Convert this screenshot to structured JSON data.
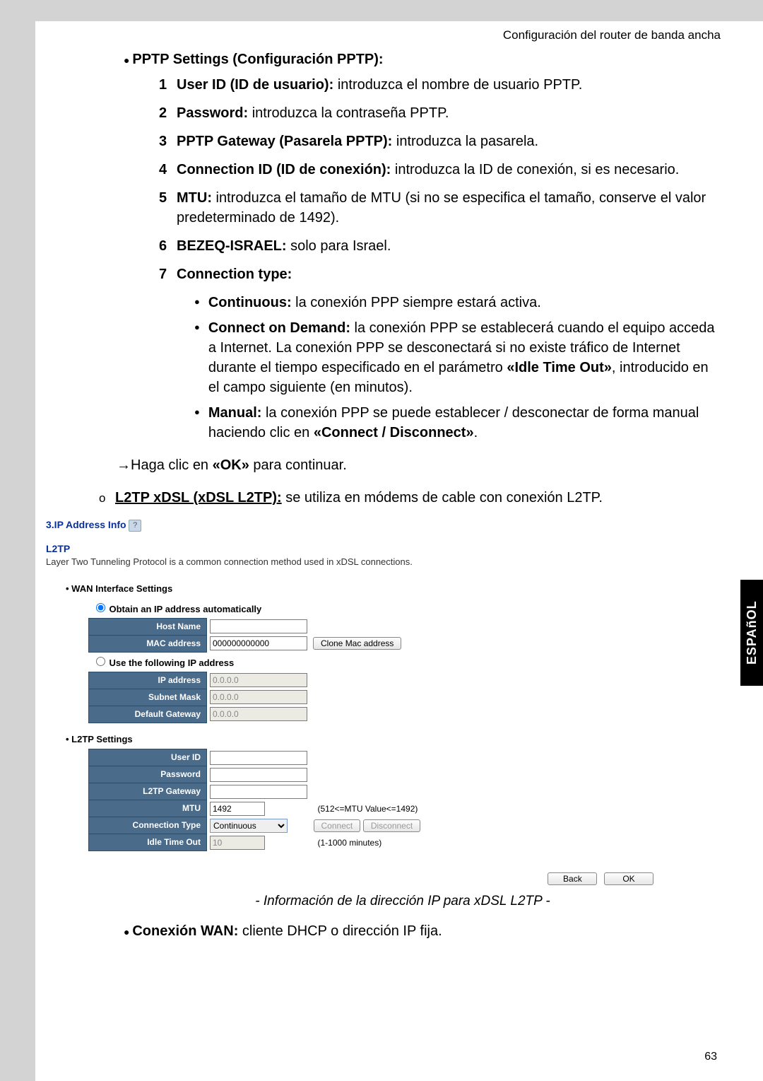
{
  "header": "Configuración del router de banda ancha",
  "pptp_title": "PPTP Settings (Configuración PPTP):",
  "items": {
    "n1": "1",
    "t1a": "User ID (ID de usuario):",
    "t1b": " introduzca el nombre de usuario PPTP.",
    "n2": "2",
    "t2a": "Password:",
    "t2b": " introduzca la contraseña PPTP.",
    "n3": "3",
    "t3a": "PPTP Gateway (Pasarela PPTP):",
    "t3b": " introduzca la pasarela.",
    "n4": "4",
    "t4a": "Connection ID (ID de conexión):",
    "t4b": " introduzca la ID de conexión, si es necesario.",
    "n5": "5",
    "t5a": "MTU:",
    "t5b": " introduzca el tamaño de MTU (si no se especifica el tamaño, conserve el valor predeterminado de 1492).",
    "n6": "6",
    "t6a": "BEZEQ-ISRAEL:",
    "t6b": " solo para Israel.",
    "n7": "7",
    "t7a": "Connection type:"
  },
  "sub": {
    "s1a": "Continuous:",
    "s1b": " la conexión PPP siempre estará activa.",
    "s2a": "Connect on Demand:",
    "s2b": " la conexión PPP se establecerá cuando el equipo acceda a Internet. La conexión PPP se desconectará si no existe tráfico de Internet durante el tiempo especificado en el parámetro ",
    "s2c": "«Idle Time Out»",
    "s2d": ", introducido en el campo siguiente (en minutos).",
    "s3a": "Manual:",
    "s3b": " la conexión PPP se puede establecer / desconectar de forma manual haciendo clic en ",
    "s3c": "«Connect / Disconnect»",
    "s3d": "."
  },
  "arrow_pre": "→Haga clic en ",
  "arrow_b": "«OK»",
  "arrow_post": " para continuar.",
  "l2tp_line_a": "L2TP xDSL (xDSL L2TP):",
  "l2tp_line_b": " se utiliza en módems de cable con conexión L2TP.",
  "ui": {
    "section": "3.IP Address Info",
    "help": "?",
    "l2tp": "L2TP",
    "desc": "Layer Two Tunneling Protocol is a common connection method used in xDSL connections.",
    "wan_hdr": "WAN Interface Settings",
    "radio_auto": "Obtain an IP address automatically",
    "host_name": "Host Name",
    "mac": "MAC address",
    "mac_val": "000000000000",
    "clone": "Clone Mac address",
    "radio_manual": "Use the following IP address",
    "ip": "IP address",
    "ip_val": "0.0.0.0",
    "subnet": "Subnet Mask",
    "subnet_val": "0.0.0.0",
    "gw": "Default Gateway",
    "gw_val": "0.0.0.0",
    "l2tp_hdr": "L2TP Settings",
    "user_id": "User ID",
    "password": "Password",
    "l2tp_gw": "L2TP Gateway",
    "mtu": "MTU",
    "mtu_val": "1492",
    "mtu_hint": "(512<=MTU Value<=1492)",
    "conn_type": "Connection Type",
    "conn_sel": "Continuous",
    "connect": "Connect",
    "disconnect": "Disconnect",
    "idle": "Idle Time Out",
    "idle_val": "10",
    "idle_hint": "(1-1000 minutes)",
    "back": "Back",
    "ok": "OK"
  },
  "caption": "- Información de la dirección IP para xDSL L2TP -",
  "wan_line_a": "Conexión WAN:",
  "wan_line_b": " cliente DHCP o dirección IP fija.",
  "side_tab": "ESPAñOL",
  "page_num": "63"
}
